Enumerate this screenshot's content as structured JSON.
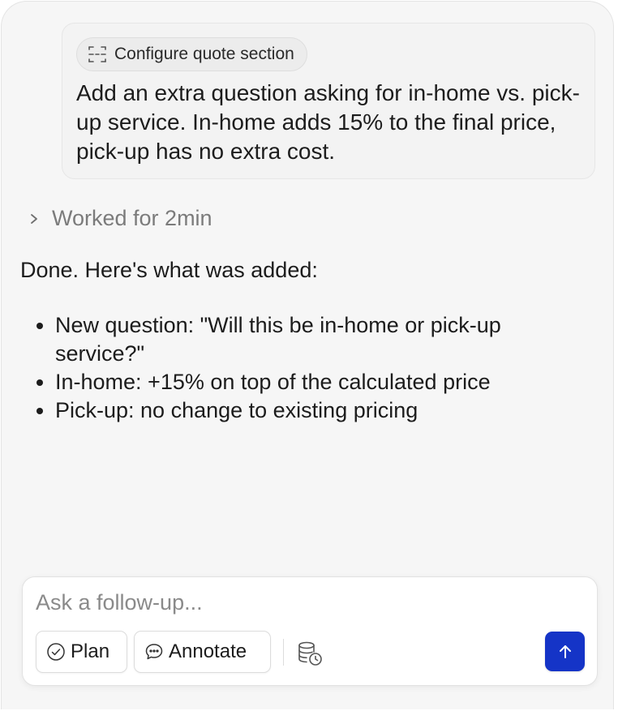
{
  "user_message": {
    "context_chip": {
      "label": "Configure quote section",
      "icon": "section-dashed-icon"
    },
    "text": "Add an extra question asking for in-home vs. pick-up service. In-home adds 15% to the final price, pick-up has no extra cost."
  },
  "worked": {
    "label": "Worked for 2min",
    "icon": "chevron-right-icon"
  },
  "response": {
    "intro": "Done. Here's what was added:",
    "bullets": [
      "New question: \"Will this be in-home or pick-up service?\"",
      "In-home: +15% on top of the calculated price",
      "Pick-up: no change to existing pricing"
    ]
  },
  "composer": {
    "placeholder": "Ask a follow-up...",
    "value": "",
    "plan_label": "Plan",
    "plan_icon": "check-circle-icon",
    "annotate_label": "Annotate",
    "annotate_icon": "chat-bubble-icon",
    "database_icon": "database-clock-icon",
    "send_icon": "arrow-up-icon"
  },
  "colors": {
    "panel_bg": "#f6f6f6",
    "send_button": "#1534c7",
    "muted_text": "#7b7b7b"
  }
}
